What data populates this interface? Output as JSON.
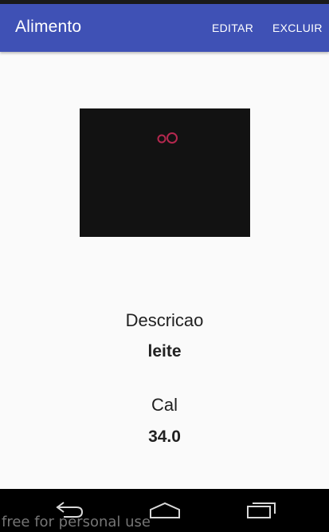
{
  "app_bar": {
    "title": "Alimento",
    "actions": [
      "EDITAR",
      "EXCLUIR"
    ],
    "color": "#3f51b5"
  },
  "photo": {
    "icon": "glasses-icon",
    "accent_color": "#b5284f"
  },
  "fields": {
    "description_label": "Descricao",
    "description_value": "leite",
    "cal_label": "Cal",
    "cal_value": "34.0"
  },
  "nav_bar": {
    "buttons": [
      "back-icon",
      "home-icon",
      "recent-apps-icon"
    ]
  },
  "watermark": "free for personal use"
}
